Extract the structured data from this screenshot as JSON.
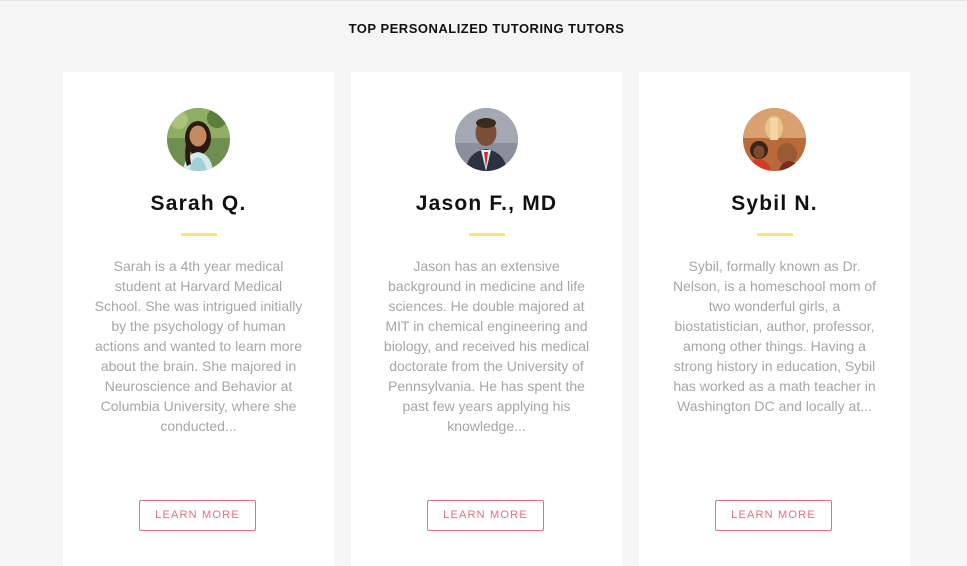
{
  "section": {
    "title": "TOP PERSONALIZED TUTORING TUTORS"
  },
  "colors": {
    "background": "#f5f5f5",
    "card": "#ffffff",
    "accent_divider": "#f1e58a",
    "button": "#e6707a",
    "bio_text": "#a6a6a6"
  },
  "tutors": [
    {
      "name": "Sarah Q.",
      "avatar_icon": "tutor-photo-sarah",
      "bio": "Sarah is a 4th year medical student at Harvard Medical School. She was intrigued initially by the psychology of human actions and wanted to learn more about the brain. She majored in Neuroscience and Behavior at Columbia University, where she conducted...",
      "button_label": "LEARN MORE"
    },
    {
      "name": "Jason F., MD",
      "avatar_icon": "tutor-photo-jason",
      "bio": "Jason has an extensive background in medicine and life sciences. He double majored at MIT in chemical engineering and biology, and received his medical doctorate from the University of Pennsylvania. He has spent the past few years applying his knowledge...",
      "button_label": "LEARN MORE"
    },
    {
      "name": "Sybil N.",
      "avatar_icon": "tutor-photo-sybil",
      "bio": "Sybil, formally known as Dr. Nelson, is a homeschool mom of two wonderful girls, a biostatistician, author, professor, among other things. Having a strong history in education, Sybil has worked as a math teacher in Washington DC and locally at...",
      "button_label": "LEARN MORE"
    }
  ]
}
